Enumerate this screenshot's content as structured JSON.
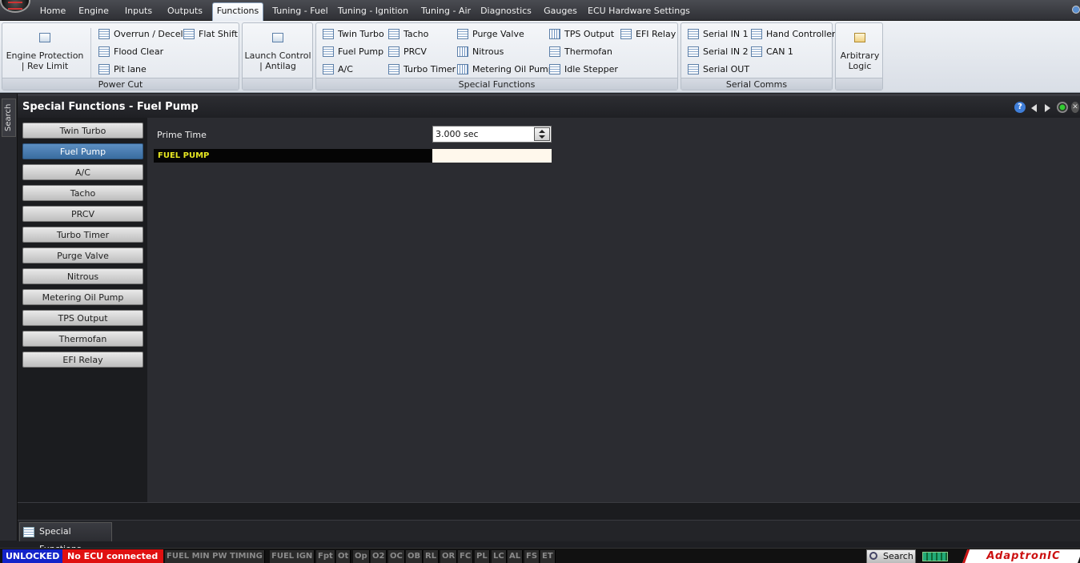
{
  "menubar": {
    "items": [
      "Home",
      "Engine",
      "Inputs",
      "Outputs",
      "Functions",
      "Tuning - Fuel",
      "Tuning - Ignition",
      "Tuning - Air",
      "Diagnostics",
      "Gauges",
      "ECU Hardware Settings"
    ],
    "active": "Functions"
  },
  "ribbon": {
    "power_cut": {
      "label": "Power Cut",
      "engine_protection": "Engine Protection | Rev Limit",
      "overrun": "Overrun / Decel",
      "flat_shift": "Flat Shift",
      "flood_clear": "Flood Clear",
      "pit_lane": "Pit lane"
    },
    "launch_control": "Launch Control | Antilag",
    "special_functions": {
      "label": "Special Functions",
      "items": [
        "Twin Turbo",
        "Fuel Pump",
        "A/C",
        "Tacho",
        "PRCV",
        "Turbo Timer",
        "Purge Valve",
        "Nitrous",
        "Metering Oil Pump",
        "TPS Output",
        "Thermofan",
        "Idle Stepper",
        "EFI Relay"
      ]
    },
    "serial_comms": {
      "label": "Serial Comms",
      "items": [
        "Serial IN 1",
        "Serial IN 2",
        "Serial OUT",
        "Hand Controller",
        "CAN 1"
      ]
    },
    "arbitrary_logic": "Arbitrary Logic"
  },
  "search_tab": "Search",
  "page": {
    "title": "Special Functions - Fuel Pump",
    "help": "?"
  },
  "sidebar": {
    "items": [
      "Twin Turbo",
      "Fuel Pump",
      "A/C",
      "Tacho",
      "PRCV",
      "Turbo Timer",
      "Purge Valve",
      "Nitrous",
      "Metering Oil Pump",
      "TPS Output",
      "Thermofan",
      "EFI Relay"
    ],
    "active": "Fuel Pump"
  },
  "content": {
    "prime_time_label": "Prime Time",
    "prime_time_value": "3.000 sec",
    "section_header": "FUEL PUMP"
  },
  "doc_tab": "Special Functions",
  "status": {
    "lock": "UNLOCKED",
    "ecu": "No ECU connected",
    "flags": [
      "FUEL MIN PW",
      "TIMING",
      "FUEL",
      "IGN",
      "Fpt",
      "Ot",
      "Op",
      "O2",
      "OC",
      "OB",
      "RL",
      "OR",
      "FC",
      "PL",
      "LC",
      "AL",
      "FS",
      "ET"
    ],
    "search": "Search",
    "brand": "AdaptronIC"
  },
  "colors": {
    "accent": "#3a6c9f",
    "section_text": "#e6e622",
    "unlocked_bg": "#1323c9",
    "ecu_bg": "#e01010"
  }
}
